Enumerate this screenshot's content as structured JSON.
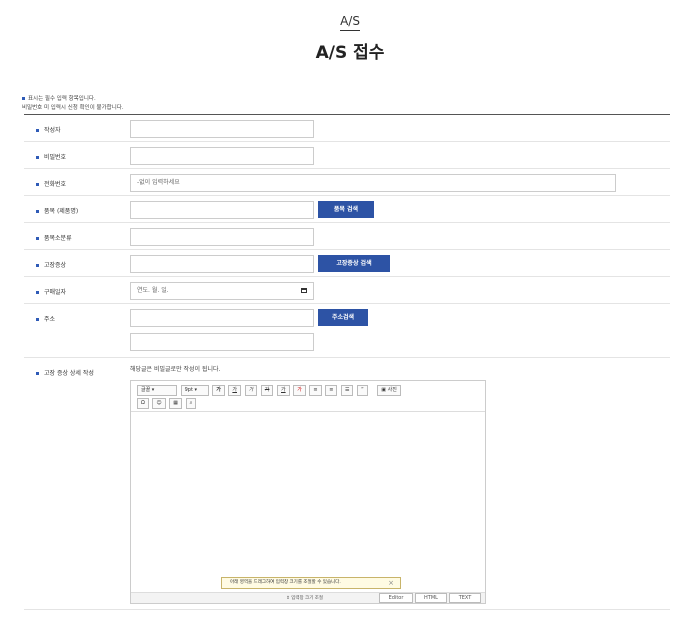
{
  "header": {
    "crumb": "A/S",
    "title": "A/S 접수"
  },
  "notice": {
    "line1": "표시는 필수 입력 항목입니다.",
    "line2": "비밀번호 미 입력시 신청 확인이 불가합니다."
  },
  "fields": {
    "writer": {
      "label": "작성자",
      "value": ""
    },
    "password": {
      "label": "비밀번호",
      "value": ""
    },
    "phone": {
      "label": "전화번호",
      "placeholder": "-없이 입력하세요"
    },
    "product": {
      "label": "품목 (제품명)",
      "button": "품목 검색"
    },
    "category": {
      "label": "품목소분류"
    },
    "symptom": {
      "label": "고장증상",
      "button": "고장증상 검색"
    },
    "purchase_date": {
      "label": "구매일자",
      "placeholder": "연도. 월. 일."
    },
    "address": {
      "label": "주소",
      "button": "주소검색"
    },
    "detail": {
      "label": "고장 증상 상세 작성",
      "hint": "해당글은 비밀글로만 작성이 됩니다."
    }
  },
  "editor": {
    "font": "글꼴",
    "size": "9pt",
    "format_buttons": [
      "가",
      "가",
      "가",
      "가",
      "가",
      "가"
    ],
    "photo": "사진",
    "tip": "아래 영역을 드래그하여 입력창 크기를 조절할 수 있습니다.",
    "resize": "입력창 크기 조절",
    "modes": [
      "Editor",
      "HTML",
      "TEXT"
    ]
  }
}
